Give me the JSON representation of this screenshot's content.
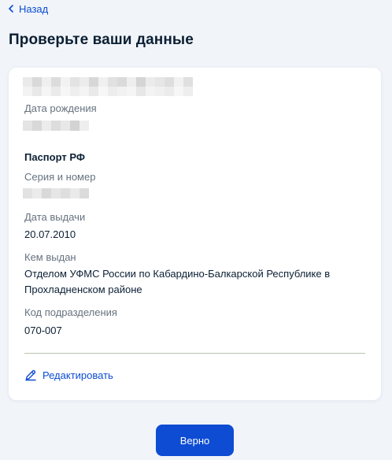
{
  "nav": {
    "back_label": "Назад"
  },
  "page": {
    "title": "Проверьте ваши данные"
  },
  "person": {
    "birth_date_label": "Дата рождения"
  },
  "passport": {
    "section_title": "Паспорт РФ",
    "series_number_label": "Серия и номер",
    "issue_date_label": "Дата выдачи",
    "issue_date_value": "20.07.2010",
    "issued_by_label": "Кем выдан",
    "issued_by_value": "Отделом УФМС России по Кабардино-Балкарской Республике в Прохладненском районе",
    "department_code_label": "Код подразделения",
    "department_code_value": "070-007"
  },
  "actions": {
    "edit_label": "Редактировать",
    "confirm_label": "Верно"
  },
  "colors": {
    "accent": "#0d4cd3",
    "text_primary": "#0b1f33",
    "text_secondary": "#66727f",
    "background": "#f1f4f9",
    "card": "#ffffff"
  }
}
